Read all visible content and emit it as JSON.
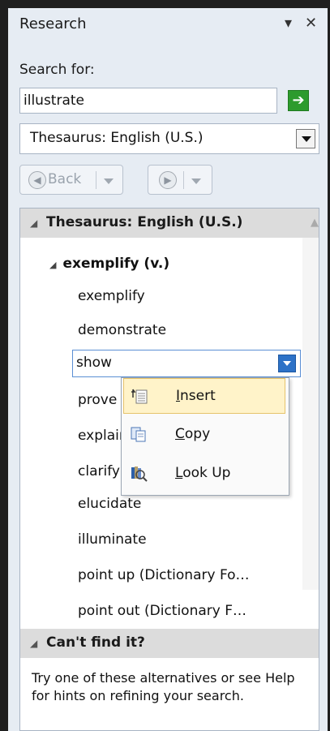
{
  "window": {
    "title": "Research",
    "dropdown_icon": "chevron-down-icon",
    "close_icon": "close-icon"
  },
  "search": {
    "label": "Search for:",
    "value": "illustrate"
  },
  "source": {
    "selected": "Thesaurus: English (U.S.)"
  },
  "nav": {
    "back_label": "Back"
  },
  "results": {
    "section_title": "Thesaurus: English (U.S.)",
    "group_word": "exemplify (v.)",
    "synonyms": [
      "exemplify",
      "demonstrate",
      "show",
      "prove",
      "explain",
      "clarify",
      "elucidate",
      "illuminate",
      "point up (Dictionary Fo…",
      "point out (Dictionary F…"
    ],
    "selected_word": "show"
  },
  "context_menu": {
    "items": [
      {
        "label": "Insert",
        "underline_char": "I"
      },
      {
        "label": "Copy",
        "underline_char": "C"
      },
      {
        "label": "Look Up",
        "underline_char": "L"
      }
    ]
  },
  "help_section": {
    "title": "Can't find it?",
    "text": "Try one of these alternatives or see Help for hints on refining your search."
  }
}
